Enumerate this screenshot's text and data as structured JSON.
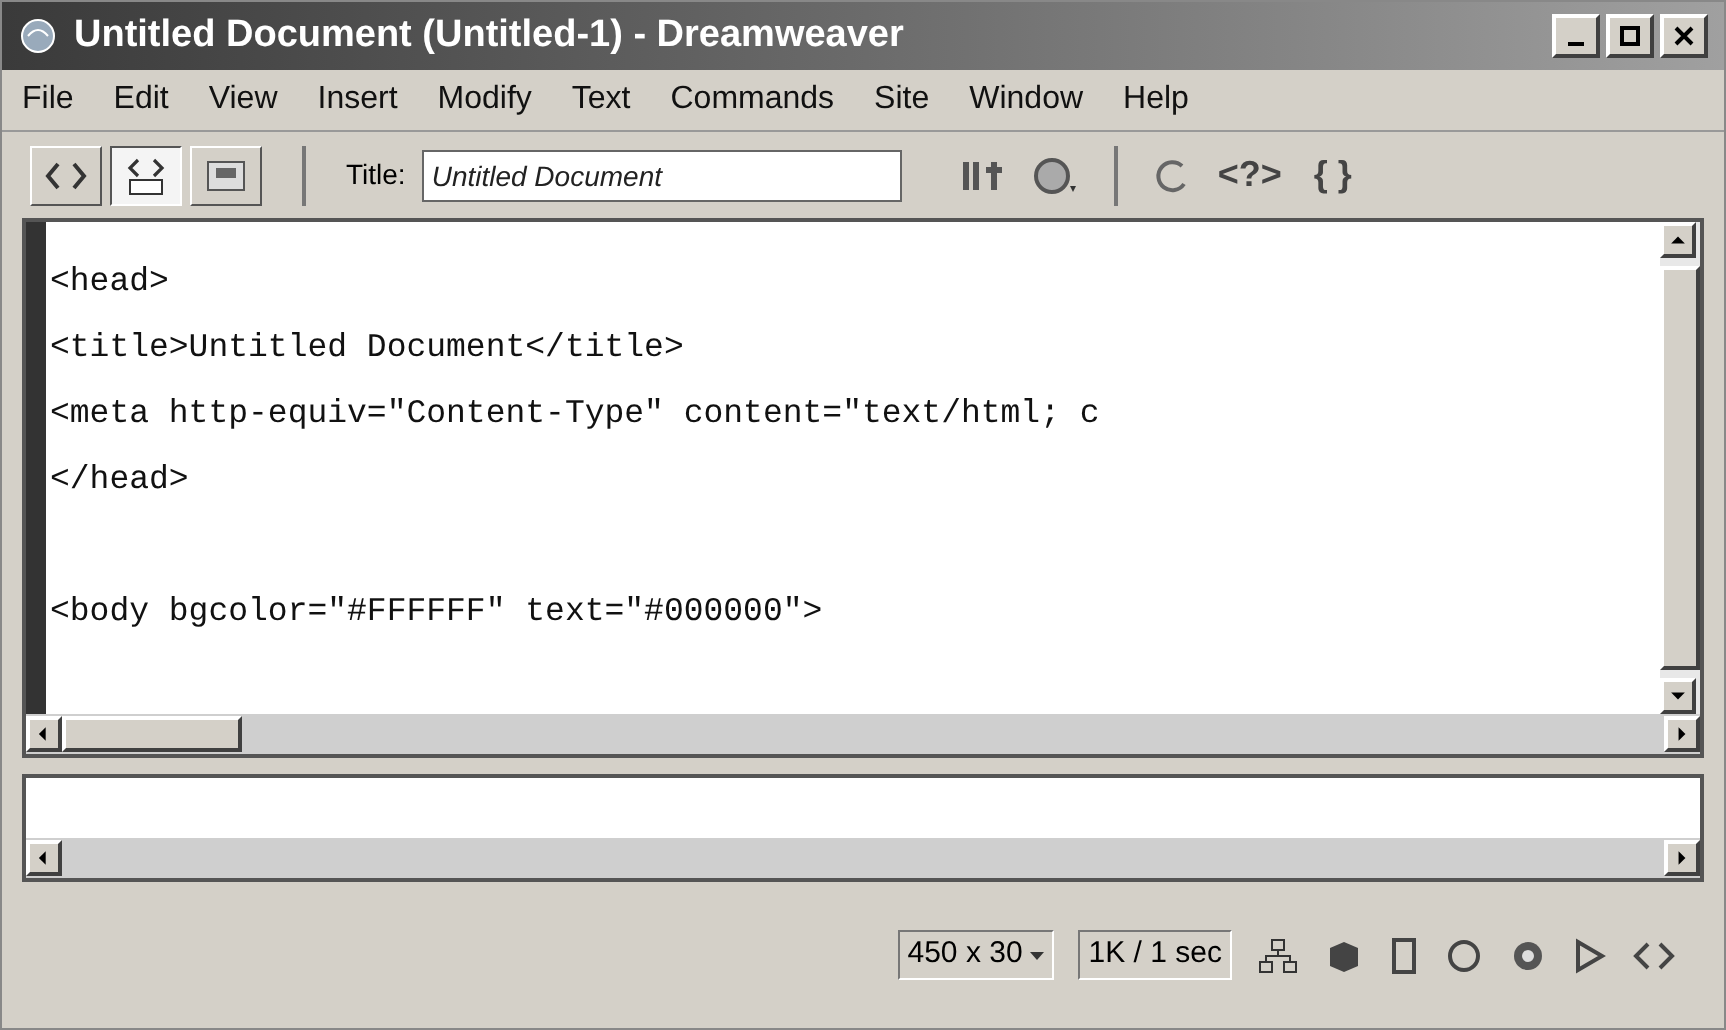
{
  "window": {
    "title": "Untitled Document (Untitled-1) - Dreamweaver"
  },
  "menu": [
    "File",
    "Edit",
    "View",
    "Insert",
    "Modify",
    "Text",
    "Commands",
    "Site",
    "Window",
    "Help"
  ],
  "view_buttons": [
    {
      "kind": "code",
      "selected": false
    },
    {
      "kind": "split",
      "selected": true
    },
    {
      "kind": "design",
      "selected": false
    }
  ],
  "title_field": {
    "label": "Title:",
    "value": "Untitled Document"
  },
  "toolbar_glyphs": [
    "<?>",
    "{ }"
  ],
  "code_blocks": [
    [
      "<head>",
      "<title>Untitled Document</title>",
      "<meta http-equiv=\"Content-Type\" content=\"text/html; c",
      "</head>"
    ],
    [
      "<body bgcolor=\"#FFFFFF\" text=\"#000000\">"
    ]
  ],
  "status_bar": {
    "window_size": "450 x 30",
    "download": "1K / 1 sec"
  }
}
